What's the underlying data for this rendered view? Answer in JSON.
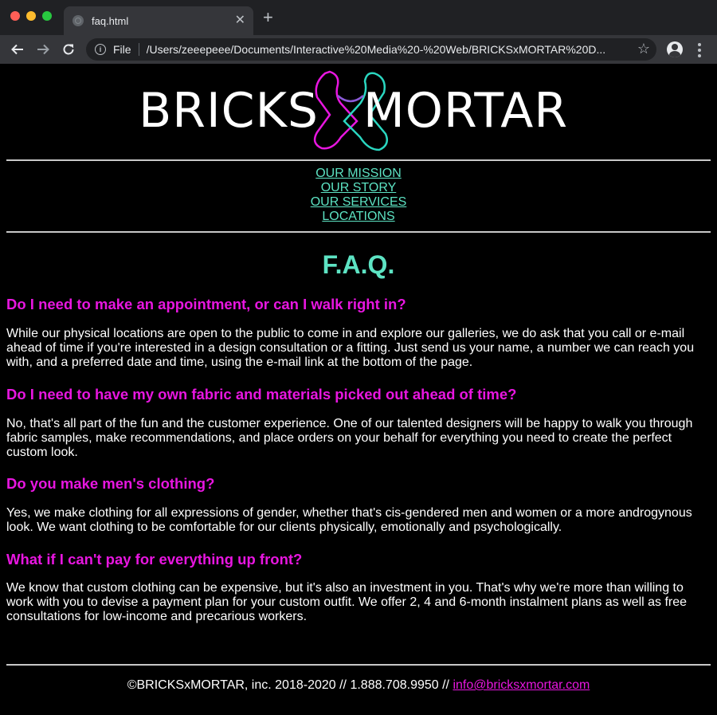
{
  "browser": {
    "tab_title": "faq.html",
    "scheme_label": "File",
    "url": "/Users/zeeepeee/Documents/Interactive%20Media%20-%20Web/BRICKSxMORTAR%20D..."
  },
  "logo": {
    "left_text": "BRICKS",
    "right_text": "MORTAR",
    "colors": {
      "text": "#ffffff",
      "x_pink": "#e816e0",
      "x_teal": "#2ad6c0"
    }
  },
  "nav": {
    "items": [
      "OUR MISSION",
      "OUR STORY",
      "OUR SERVICES",
      "LOCATIONS"
    ]
  },
  "faq": {
    "title": "F.A.Q.",
    "items": [
      {
        "question": "Do I need to make an appointment, or can I walk right in?",
        "answer": "While our physical locations are open to the public to come in and explore our galleries, we do ask that you call or e-mail ahead of time if you're interested in a design consultation or a fitting. Just send us your name, a number we can reach you with, and a preferred date and time, using the e-mail link at the bottom of the page."
      },
      {
        "question": "Do I need to have my own fabric and materials picked out ahead of time?",
        "answer": "No, that's all part of the fun and the customer experience. One of our talented designers will be happy to walk you through fabric samples, make recommendations, and place orders on your behalf for everything you need to create the perfect custom look."
      },
      {
        "question": "Do you make men's clothing?",
        "answer": "Yes, we make clothing for all expressions of gender, whether that's cis-gendered men and women or a more androgynous look. We want clothing to be comfortable for our clients physically, emotionally and psychologically."
      },
      {
        "question": "What if I can't pay for everything up front?",
        "answer": "We know that custom clothing can be expensive, but it's also an investment in you. That's why we're more than willing to work with you to devise a payment plan for your custom outfit. We offer 2, 4 and 6-month instalment plans as well as free consultations for low-income and precarious workers."
      }
    ]
  },
  "footer": {
    "text": "©BRICKSxMORTAR, inc. 2018-2020 // 1.888.708.9950 // ",
    "email": "info@bricksxmortar.com"
  },
  "colors": {
    "accent_teal": "#5de3c3",
    "accent_pink": "#e816e0",
    "background": "#000000"
  }
}
